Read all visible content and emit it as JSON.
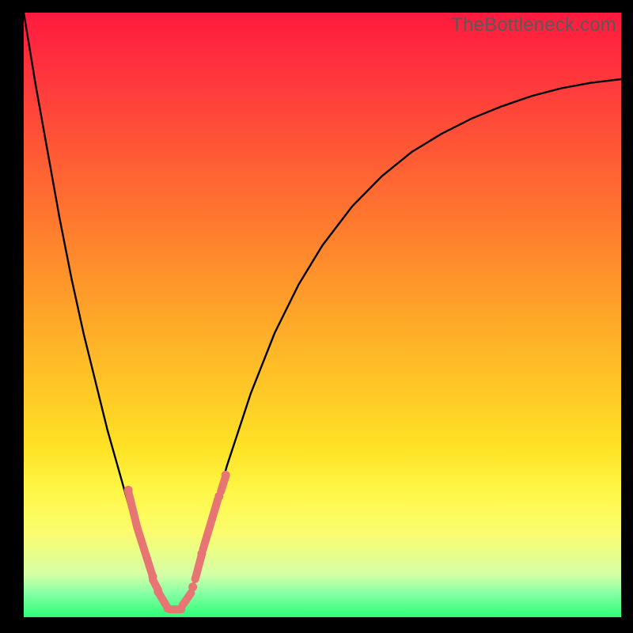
{
  "watermark": "TheBottleneck.com",
  "palette": {
    "c0": "#ff1a3f",
    "c1": "#ff3a3c",
    "c2": "#ff7a2e",
    "c3": "#ffb427",
    "c4": "#ffe225",
    "c5": "#fff746",
    "c6": "#fbfd6e",
    "c7": "#d4ffa6",
    "c8": "#87ffa5",
    "c9": "#2cff77"
  },
  "chart_data": {
    "type": "line",
    "title": "",
    "xlabel": "",
    "ylabel": "",
    "xlim": [
      0,
      1
    ],
    "ylim": [
      0,
      1
    ],
    "x": [
      0.0,
      0.02,
      0.04,
      0.06,
      0.08,
      0.1,
      0.12,
      0.14,
      0.16,
      0.18,
      0.2,
      0.22,
      0.23,
      0.24,
      0.25,
      0.26,
      0.28,
      0.3,
      0.34,
      0.38,
      0.42,
      0.46,
      0.5,
      0.55,
      0.6,
      0.65,
      0.7,
      0.75,
      0.8,
      0.85,
      0.9,
      0.95,
      1.0
    ],
    "values": [
      1.0,
      0.88,
      0.77,
      0.66,
      0.56,
      0.47,
      0.39,
      0.31,
      0.24,
      0.17,
      0.11,
      0.06,
      0.04,
      0.02,
      0.01,
      0.01,
      0.04,
      0.11,
      0.25,
      0.37,
      0.47,
      0.55,
      0.615,
      0.68,
      0.73,
      0.77,
      0.8,
      0.825,
      0.845,
      0.862,
      0.875,
      0.884,
      0.89
    ],
    "highlight_strips": [
      {
        "x0": 0.175,
        "y0": 0.208,
        "x1": 0.19,
        "y1": 0.148
      },
      {
        "x0": 0.19,
        "y0": 0.148,
        "x1": 0.215,
        "y1": 0.07
      },
      {
        "x0": 0.216,
        "y0": 0.062,
        "x1": 0.225,
        "y1": 0.045
      },
      {
        "x0": 0.226,
        "y0": 0.04,
        "x1": 0.238,
        "y1": 0.02
      },
      {
        "x0": 0.244,
        "y0": 0.013,
        "x1": 0.264,
        "y1": 0.013
      },
      {
        "x0": 0.266,
        "y0": 0.02,
        "x1": 0.28,
        "y1": 0.04
      },
      {
        "x0": 0.287,
        "y0": 0.063,
        "x1": 0.297,
        "y1": 0.1
      },
      {
        "x0": 0.3,
        "y0": 0.112,
        "x1": 0.325,
        "y1": 0.195
      },
      {
        "x0": 0.33,
        "y0": 0.208,
        "x1": 0.338,
        "y1": 0.233
      }
    ],
    "highlight_points": [
      {
        "x": 0.175,
        "y": 0.21
      },
      {
        "x": 0.216,
        "y": 0.067
      },
      {
        "x": 0.225,
        "y": 0.042
      },
      {
        "x": 0.241,
        "y": 0.015
      },
      {
        "x": 0.283,
        "y": 0.05
      },
      {
        "x": 0.298,
        "y": 0.105
      },
      {
        "x": 0.327,
        "y": 0.2
      },
      {
        "x": 0.338,
        "y": 0.235
      }
    ]
  }
}
